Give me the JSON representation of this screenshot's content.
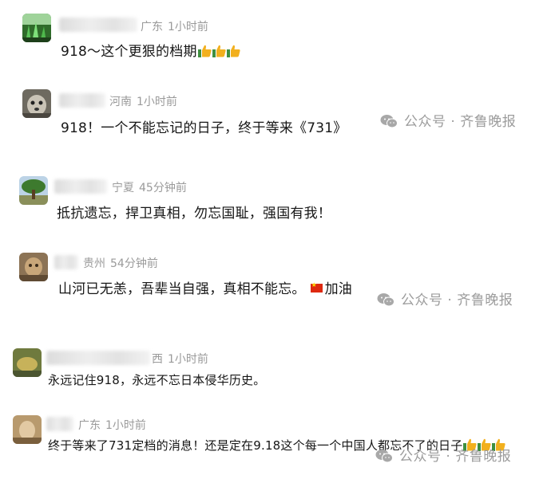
{
  "comments": [
    {
      "location": "广东",
      "time": "1小时前",
      "text": "918～这个更狠的档期",
      "thumbs": 3
    },
    {
      "location": "河南",
      "time": "1小时前",
      "text": "918！一个不能忘记的日子，终于等来《731》"
    },
    {
      "location": "宁夏",
      "time": "45分钟前",
      "text": "抵抗遗忘，捍卫真相，勿忘国耻，强国有我！"
    },
    {
      "location": "贵州",
      "time": "54分钟前",
      "text": "山河已无恙，吾辈当自强，真相不能忘。",
      "text_suffix": "加油"
    },
    {
      "location": "西",
      "time": "1小时前",
      "text": "永远记住918，永远不忘日本侵华历史。"
    },
    {
      "location": "广东",
      "time": "1小时前",
      "text": "终于等来了731定档的消息！还是定在9.18这个每一个中国人都忘不了的日子",
      "thumbs": 3
    }
  ],
  "watermark": {
    "text": "公众号 · 齐鲁晚报"
  },
  "colors": {
    "text": "#161616",
    "meta": "#9a9a9a",
    "watermark": "#9c9c9c",
    "thumb": "#f2b01e"
  },
  "icons": {
    "thumb": "thumbs-up-emoji-icon",
    "flag": "china-flag-icon",
    "watermark": "wechat-icon"
  }
}
